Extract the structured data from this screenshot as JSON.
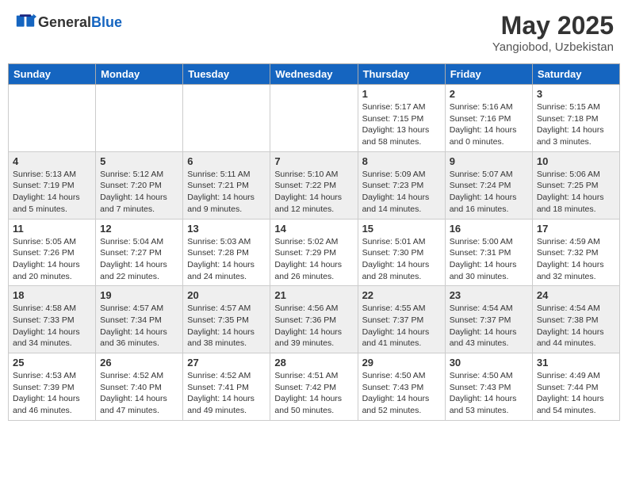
{
  "header": {
    "logo_general": "General",
    "logo_blue": "Blue",
    "month_year": "May 2025",
    "location": "Yangiobod, Uzbekistan"
  },
  "weekdays": [
    "Sunday",
    "Monday",
    "Tuesday",
    "Wednesday",
    "Thursday",
    "Friday",
    "Saturday"
  ],
  "weeks": [
    [
      {
        "day": "",
        "info": ""
      },
      {
        "day": "",
        "info": ""
      },
      {
        "day": "",
        "info": ""
      },
      {
        "day": "",
        "info": ""
      },
      {
        "day": "1",
        "info": "Sunrise: 5:17 AM\nSunset: 7:15 PM\nDaylight: 13 hours\nand 58 minutes."
      },
      {
        "day": "2",
        "info": "Sunrise: 5:16 AM\nSunset: 7:16 PM\nDaylight: 14 hours\nand 0 minutes."
      },
      {
        "day": "3",
        "info": "Sunrise: 5:15 AM\nSunset: 7:18 PM\nDaylight: 14 hours\nand 3 minutes."
      }
    ],
    [
      {
        "day": "4",
        "info": "Sunrise: 5:13 AM\nSunset: 7:19 PM\nDaylight: 14 hours\nand 5 minutes."
      },
      {
        "day": "5",
        "info": "Sunrise: 5:12 AM\nSunset: 7:20 PM\nDaylight: 14 hours\nand 7 minutes."
      },
      {
        "day": "6",
        "info": "Sunrise: 5:11 AM\nSunset: 7:21 PM\nDaylight: 14 hours\nand 9 minutes."
      },
      {
        "day": "7",
        "info": "Sunrise: 5:10 AM\nSunset: 7:22 PM\nDaylight: 14 hours\nand 12 minutes."
      },
      {
        "day": "8",
        "info": "Sunrise: 5:09 AM\nSunset: 7:23 PM\nDaylight: 14 hours\nand 14 minutes."
      },
      {
        "day": "9",
        "info": "Sunrise: 5:07 AM\nSunset: 7:24 PM\nDaylight: 14 hours\nand 16 minutes."
      },
      {
        "day": "10",
        "info": "Sunrise: 5:06 AM\nSunset: 7:25 PM\nDaylight: 14 hours\nand 18 minutes."
      }
    ],
    [
      {
        "day": "11",
        "info": "Sunrise: 5:05 AM\nSunset: 7:26 PM\nDaylight: 14 hours\nand 20 minutes."
      },
      {
        "day": "12",
        "info": "Sunrise: 5:04 AM\nSunset: 7:27 PM\nDaylight: 14 hours\nand 22 minutes."
      },
      {
        "day": "13",
        "info": "Sunrise: 5:03 AM\nSunset: 7:28 PM\nDaylight: 14 hours\nand 24 minutes."
      },
      {
        "day": "14",
        "info": "Sunrise: 5:02 AM\nSunset: 7:29 PM\nDaylight: 14 hours\nand 26 minutes."
      },
      {
        "day": "15",
        "info": "Sunrise: 5:01 AM\nSunset: 7:30 PM\nDaylight: 14 hours\nand 28 minutes."
      },
      {
        "day": "16",
        "info": "Sunrise: 5:00 AM\nSunset: 7:31 PM\nDaylight: 14 hours\nand 30 minutes."
      },
      {
        "day": "17",
        "info": "Sunrise: 4:59 AM\nSunset: 7:32 PM\nDaylight: 14 hours\nand 32 minutes."
      }
    ],
    [
      {
        "day": "18",
        "info": "Sunrise: 4:58 AM\nSunset: 7:33 PM\nDaylight: 14 hours\nand 34 minutes."
      },
      {
        "day": "19",
        "info": "Sunrise: 4:57 AM\nSunset: 7:34 PM\nDaylight: 14 hours\nand 36 minutes."
      },
      {
        "day": "20",
        "info": "Sunrise: 4:57 AM\nSunset: 7:35 PM\nDaylight: 14 hours\nand 38 minutes."
      },
      {
        "day": "21",
        "info": "Sunrise: 4:56 AM\nSunset: 7:36 PM\nDaylight: 14 hours\nand 39 minutes."
      },
      {
        "day": "22",
        "info": "Sunrise: 4:55 AM\nSunset: 7:37 PM\nDaylight: 14 hours\nand 41 minutes."
      },
      {
        "day": "23",
        "info": "Sunrise: 4:54 AM\nSunset: 7:37 PM\nDaylight: 14 hours\nand 43 minutes."
      },
      {
        "day": "24",
        "info": "Sunrise: 4:54 AM\nSunset: 7:38 PM\nDaylight: 14 hours\nand 44 minutes."
      }
    ],
    [
      {
        "day": "25",
        "info": "Sunrise: 4:53 AM\nSunset: 7:39 PM\nDaylight: 14 hours\nand 46 minutes."
      },
      {
        "day": "26",
        "info": "Sunrise: 4:52 AM\nSunset: 7:40 PM\nDaylight: 14 hours\nand 47 minutes."
      },
      {
        "day": "27",
        "info": "Sunrise: 4:52 AM\nSunset: 7:41 PM\nDaylight: 14 hours\nand 49 minutes."
      },
      {
        "day": "28",
        "info": "Sunrise: 4:51 AM\nSunset: 7:42 PM\nDaylight: 14 hours\nand 50 minutes."
      },
      {
        "day": "29",
        "info": "Sunrise: 4:50 AM\nSunset: 7:43 PM\nDaylight: 14 hours\nand 52 minutes."
      },
      {
        "day": "30",
        "info": "Sunrise: 4:50 AM\nSunset: 7:43 PM\nDaylight: 14 hours\nand 53 minutes."
      },
      {
        "day": "31",
        "info": "Sunrise: 4:49 AM\nSunset: 7:44 PM\nDaylight: 14 hours\nand 54 minutes."
      }
    ]
  ]
}
